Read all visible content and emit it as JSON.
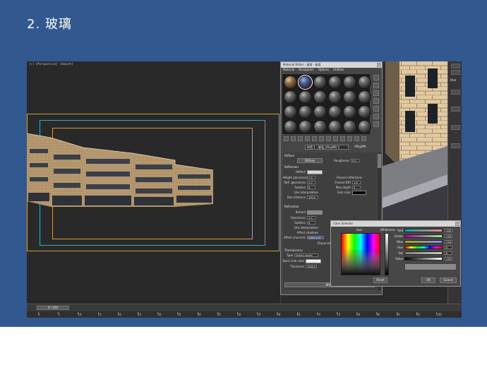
{
  "slide": {
    "title": "2. 玻璃",
    "background": "#31588f"
  },
  "viewport": {
    "label": "[+] [Perspective] [Smooth]"
  },
  "material_editor": {
    "title": "Material Editor - 玻璃 - 玻璃",
    "close": "×",
    "menu": [
      "Material",
      "Navigation",
      "Options",
      "Utilities"
    ],
    "material_name": "砖墙 1 - 玻璃_VRayMtl 2",
    "material_type": "VRayMtl",
    "sections": {
      "diffuse": "Diffuse",
      "reflection": "Reflection",
      "refraction": "Refraction",
      "translucency": "Translucency"
    },
    "diffuse": {
      "button": "Diffuse",
      "roughness_label": "Roughness",
      "roughness_value": "0.0"
    },
    "reflection": {
      "reflect_label": "Reflect",
      "hilight_gloss_label": "Hilight glossiness",
      "hilight_gloss_value": "1.0",
      "refl_gloss_label": "Refl. glossiness",
      "refl_gloss_value": "1.0",
      "subdivs_label": "Subdivs",
      "subdivs_value": "8",
      "use_interp_label": "Use interpolation",
      "dim_distance_label": "Dim distance",
      "dim_distance_value": "100.0",
      "fresnel_label": "Fresnel reflections",
      "fresnel_ior_label": "Fresnel IOR",
      "fresnel_ior_value": "1.6",
      "max_depth_label": "Max depth",
      "max_depth_value": "5",
      "exit_color_label": "Exit color"
    },
    "refraction": {
      "refract_label": "Refract",
      "glossiness_label": "Glossiness",
      "glossiness_value": "1.0",
      "subdivs_label": "Subdivs",
      "subdivs_value": "8",
      "use_interp_label": "Use interpolation",
      "affect_shadows_label": "Affect shadows",
      "affect_channels_label": "Affect channels",
      "affect_channels_value": "Color only",
      "dispersion_label": "Dispersion"
    },
    "translucency": {
      "type_label": "Type",
      "type_value": "Hybrid model",
      "back_side_label": "Back-side color",
      "thickness_label": "Thickness",
      "thickness_value": "1000.0"
    },
    "brdf": "BRDF"
  },
  "color_selection": {
    "title": "Color Selector",
    "close": "×",
    "hue_label": "Hue",
    "whiteness_label": "Whiteness",
    "channels": [
      {
        "label": "Red",
        "value": "128"
      },
      {
        "label": "Green",
        "value": "128"
      },
      {
        "label": "Blue",
        "value": "128"
      },
      {
        "label": "Hue",
        "value": "0"
      },
      {
        "label": "Sat",
        "value": "0"
      },
      {
        "label": "Value",
        "value": "128"
      }
    ],
    "reset": "Reset",
    "ok": "OK",
    "cancel": "Cancel"
  },
  "timeline": {
    "frame": "0 / 100",
    "ticks": [
      "0",
      "5",
      "10",
      "15",
      "20",
      "25",
      "30",
      "35",
      "40",
      "45",
      "50",
      "55",
      "60",
      "65",
      "70",
      "75",
      "80",
      "85",
      "90",
      "95",
      "100"
    ]
  },
  "right_panel": {
    "label": "Mod"
  },
  "colors": {
    "frame_yellow": "#c9a23a",
    "frame_cyan": "#3aa9b8",
    "frame_orange": "#d49a3a",
    "brick": "#c9ab80"
  }
}
